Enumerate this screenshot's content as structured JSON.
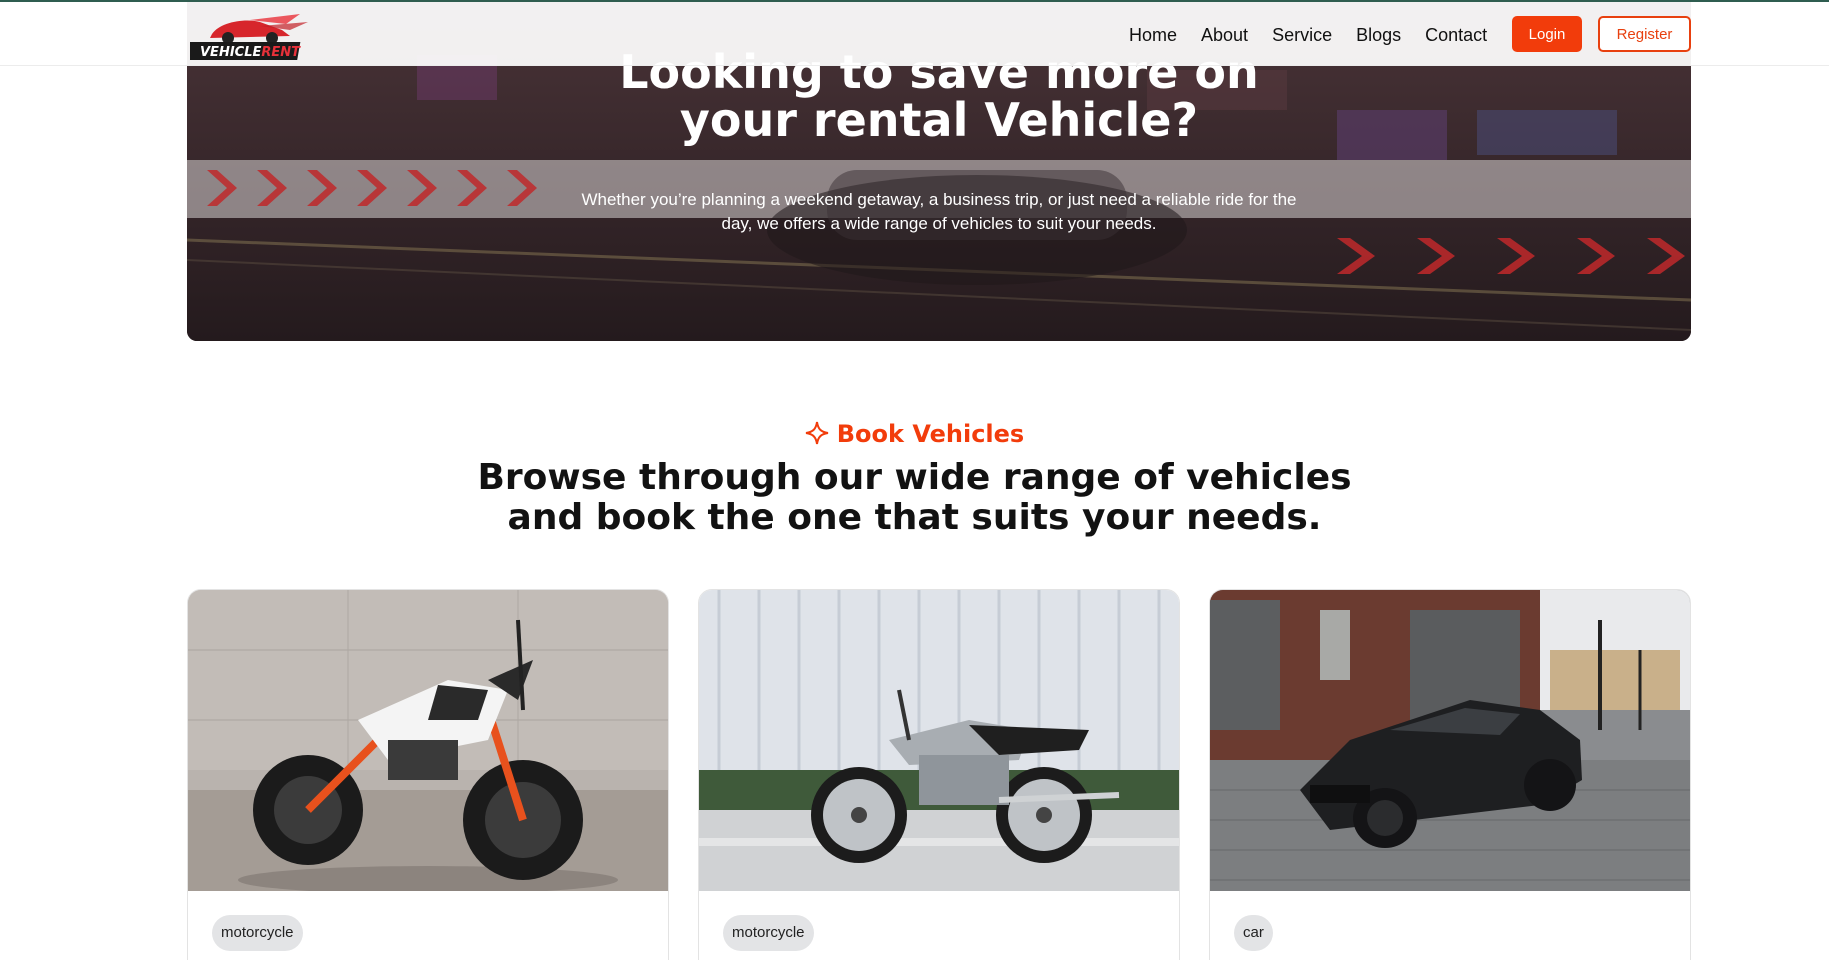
{
  "brand": {
    "logo_text": "VEHICLERENT"
  },
  "nav": {
    "links": [
      "Home",
      "About",
      "Service",
      "Blogs",
      "Contact"
    ],
    "login_label": "Login",
    "register_label": "Register"
  },
  "hero": {
    "title_line1": "Looking to save more on",
    "title_line2": "your rental Vehicle?",
    "subtitle": "Whether you’re planning a weekend getaway, a business trip, or just need a reliable ride for the day, we offers a wide range of vehicles to suit your needs."
  },
  "section": {
    "eyebrow": "Book Vehicles",
    "title_line1": "Browse through our wide range of vehicles",
    "title_line2": "and book the one that suits your needs."
  },
  "cards": [
    {
      "type_tag": "motorcycle"
    },
    {
      "type_tag": "motorcycle"
    },
    {
      "type_tag": "car"
    }
  ],
  "colors": {
    "accent": "#f23c0b",
    "text": "#121212",
    "tag_bg": "#e3e4e6"
  }
}
